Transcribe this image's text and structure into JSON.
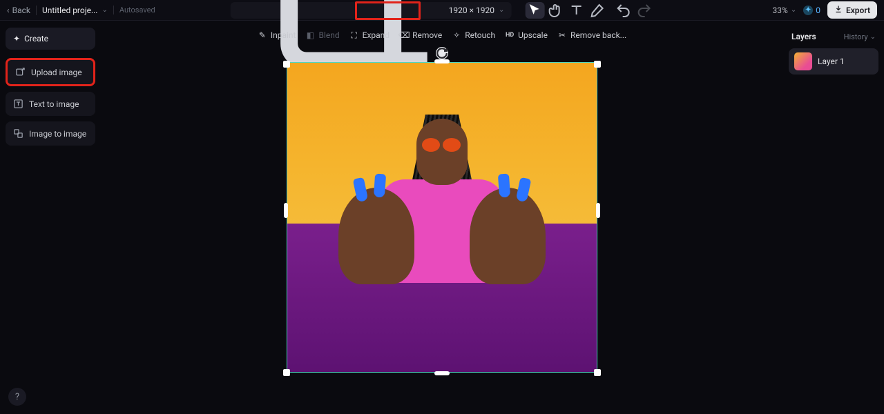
{
  "header": {
    "back": "Back",
    "title": "Untitled proje...",
    "autosaved": "Autosaved",
    "canvas_size": "1920 × 1920",
    "zoom": "33%",
    "credits": "0",
    "export": "Export"
  },
  "editbar": {
    "inpaint": "Inpaint",
    "blend": "Blend",
    "expand": "Expand",
    "remove": "Remove",
    "retouch": "Retouch",
    "upscale": "Upscale",
    "removebg": "Remove back..."
  },
  "sidebar": {
    "create": "Create",
    "items": [
      "Upload image",
      "Text to image",
      "Image to image"
    ]
  },
  "layers_panel": {
    "title": "Layers",
    "history": "History",
    "items": [
      "Layer 1"
    ]
  }
}
